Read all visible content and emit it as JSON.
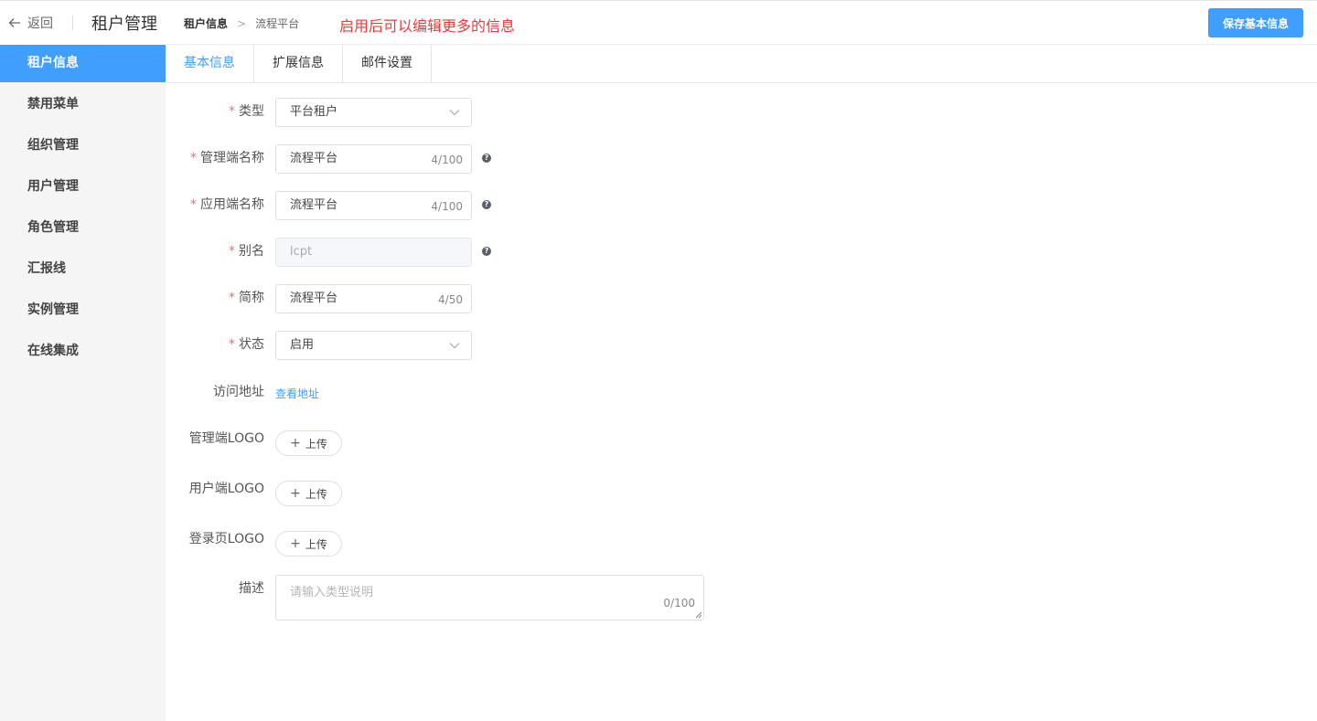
{
  "header": {
    "back_label": "返回",
    "app_title": "租户管理",
    "breadcrumb": [
      "租户信息",
      "流程平台"
    ],
    "breadcrumb_sep": ">",
    "notice": "启用后可以编辑更多的信息",
    "save_label": "保存基本信息"
  },
  "sidebar": {
    "items": [
      {
        "label": "租户信息",
        "active": true
      },
      {
        "label": "禁用菜单"
      },
      {
        "label": "组织管理"
      },
      {
        "label": "用户管理"
      },
      {
        "label": "角色管理"
      },
      {
        "label": "汇报线"
      },
      {
        "label": "实例管理"
      },
      {
        "label": "在线集成"
      }
    ]
  },
  "tabs": [
    {
      "label": "基本信息",
      "active": true
    },
    {
      "label": "扩展信息"
    },
    {
      "label": "邮件设置"
    }
  ],
  "form": {
    "type": {
      "label": "类型",
      "value": "平台租户"
    },
    "admin_name": {
      "label": "管理端名称",
      "value": "流程平台",
      "count": "4/100"
    },
    "app_name": {
      "label": "应用端名称",
      "value": "流程平台",
      "count": "4/100"
    },
    "alias": {
      "label": "别名",
      "value": "lcpt"
    },
    "short_name": {
      "label": "简称",
      "value": "流程平台",
      "count": "4/50"
    },
    "status": {
      "label": "状态",
      "value": "启用"
    },
    "access_url": {
      "label": "访问地址",
      "link": "查看地址"
    },
    "admin_logo": {
      "label": "管理端LOGO",
      "button": "上传"
    },
    "user_logo": {
      "label": "用户端LOGO",
      "button": "上传"
    },
    "login_logo": {
      "label": "登录页LOGO",
      "button": "上传"
    },
    "description": {
      "label": "描述",
      "placeholder": "请输入类型说明",
      "count": "0/100"
    },
    "required_mark": "*",
    "help_glyph": "?"
  },
  "colors": {
    "accent": "#409eff",
    "notice": "#f03a3a",
    "required": "#f56c6c"
  }
}
